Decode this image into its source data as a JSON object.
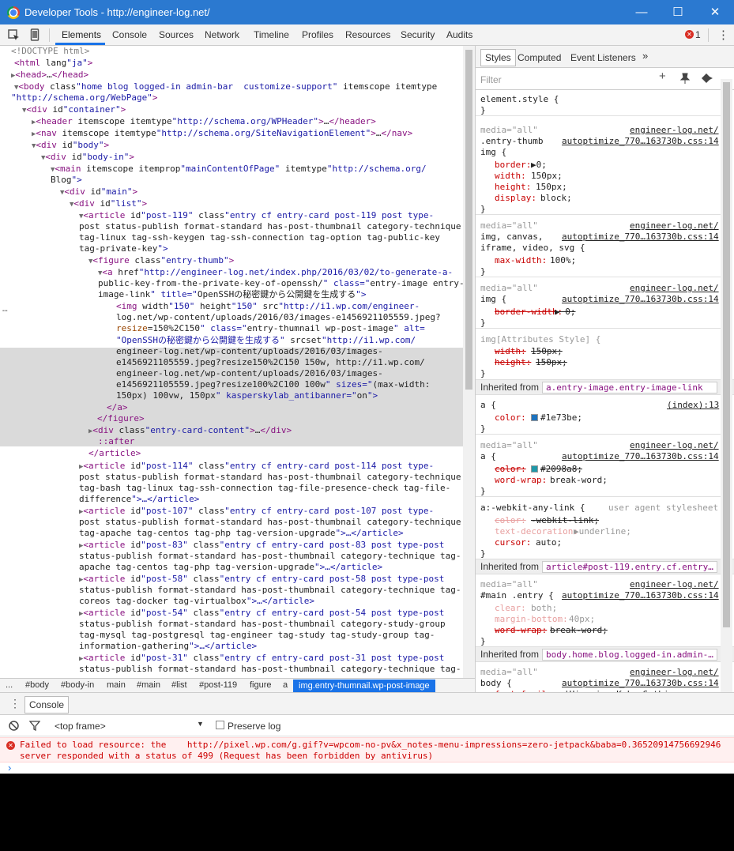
{
  "window": {
    "title": "Developer Tools - http://engineer-log.net/",
    "minimize": "—",
    "maximize": "☐",
    "close": "✕"
  },
  "toolbar": {
    "tabs": [
      "Elements",
      "Console",
      "Sources",
      "Network",
      "Timeline",
      "Profiles",
      "Resources",
      "Security",
      "Audits"
    ],
    "error_count": "1",
    "more": "⋮"
  },
  "dom_lines": [
    {
      "t": "<!DOCTYPE html>",
      "cls": "gr"
    },
    {
      "t": "<html lang=\"ja\">"
    },
    {
      "t": "▶<head>…</head>"
    },
    {
      "t": "▼<body class=\"home blog logged-in admin-bar  customize-support\" itemscope itemtype="
    },
    {
      "t": "\"http://schema.org/WebPage\">"
    },
    {
      "t": "▼<div id=\"container\">"
    },
    {
      "t": "▶<header itemscope itemtype=\"http://schema.org/WPHeader\">…</header>"
    },
    {
      "t": "▶<nav itemscope itemtype=\"http://schema.org/SiteNavigationElement\">…</nav>"
    },
    {
      "t": "▼<div id=\"body\">"
    },
    {
      "t": "▼<div id=\"body-in\">"
    },
    {
      "t": "▼<main itemscope itemprop=\"mainContentOfPage\" itemtype=\"http://schema.org/"
    },
    {
      "t": "Blog\">"
    },
    {
      "t": "▼<div id=\"main\">"
    },
    {
      "t": "▼<div id=\"list\">"
    },
    {
      "t": "▼<article id=\"post-119\" class=\"entry cf entry-card post-119 post type-"
    },
    {
      "t": "post status-publish format-standard has-post-thumbnail category-technique"
    },
    {
      "t": "tag-linux tag-ssh-keygen tag-ssh-connection tag-option tag-public-key"
    },
    {
      "t": "tag-private-key\">"
    },
    {
      "t": "▼<figure class=\"entry-thumb\">"
    },
    {
      "t": "▼<a href=\"http://engineer-log.net/index.php/2016/03/02/to-generate-a-"
    },
    {
      "t": "public-key-from-the-private-key-of-openssh/\" class=\"entry-image entry-"
    },
    {
      "t": "image-link\" title=\"OpenSSHの秘密鍵から公開鍵を生成する\">"
    },
    {
      "t": "<img width=\"150\" height=\"150\" src=\"http://i1.wp.com/engineer-"
    },
    {
      "t": "log.net/wp-content/uploads/2016/03/images-e1456921105559.jpeg?"
    },
    {
      "t": "resize=150%2C150\" class=\"entry-thumnail wp-post-image\" alt="
    },
    {
      "t": "\"OpenSSHの秘密鍵から公開鍵を生成する\" srcset=\"http://i1.wp.com/"
    },
    {
      "t": "engineer-log.net/wp-content/uploads/2016/03/images-"
    },
    {
      "t": "e1456921105559.jpeg?resize=150%2C150 150w, http://i1.wp.com/"
    },
    {
      "t": "engineer-log.net/wp-content/uploads/2016/03/images-"
    },
    {
      "t": "e1456921105559.jpeg?resize=100%2C100 100w\" sizes=\"(max-width:"
    },
    {
      "t": "150px) 100vw, 150px\" kasperskylab_antibanner=\"on\">"
    },
    {
      "t": "</a>"
    },
    {
      "t": "</figure>"
    },
    {
      "t": "▶<div class=\"entry-card-content\">…</div>"
    },
    {
      "t": "::after"
    },
    {
      "t": "</article>"
    },
    {
      "t": "▶<article id=\"post-114\" class=\"entry cf entry-card post-114 post type-"
    },
    {
      "t": "post status-publish format-standard has-post-thumbnail category-technique"
    },
    {
      "t": "tag-bash tag-linux tag-ssh-connection tag-file-presence-check tag-file-"
    },
    {
      "t": "difference\">…</article>"
    },
    {
      "t": "▶<article id=\"post-107\" class=\"entry cf entry-card post-107 post type-"
    },
    {
      "t": "post status-publish format-standard has-post-thumbnail category-technique"
    },
    {
      "t": "tag-apache tag-centos tag-php tag-version-upgrade\">…</article>"
    },
    {
      "t": "▶<article id=\"post-83\" class=\"entry cf entry-card post-83 post type-post"
    },
    {
      "t": "status-publish format-standard has-post-thumbnail category-technique tag-"
    },
    {
      "t": "apache tag-centos tag-php tag-version-upgrade\">…</article>"
    },
    {
      "t": "▶<article id=\"post-58\" class=\"entry cf entry-card post-58 post type-post"
    },
    {
      "t": "status-publish format-standard has-post-thumbnail category-technique tag-"
    },
    {
      "t": "coreos tag-docker tag-virtualbox\">…</article>"
    },
    {
      "t": "▶<article id=\"post-54\" class=\"entry cf entry-card post-54 post type-post"
    },
    {
      "t": "status-publish format-standard has-post-thumbnail category-study-group"
    },
    {
      "t": "tag-mysql tag-postgresql tag-engineer tag-study tag-study-group tag-"
    },
    {
      "t": "information-gathering\">…</article>"
    },
    {
      "t": "▶<article id=\"post-31\" class=\"entry cf entry-card post-31 post type-post"
    },
    {
      "t": "status-publish format-standard has-post-thumbnail category-technique tag-"
    }
  ],
  "breadcrumbs": [
    "...",
    "#body",
    "#body-in",
    "main",
    "#main",
    "#list",
    "#post-119",
    "figure",
    "a",
    "img.entry-thumnail.wp-post-image"
  ],
  "styles": {
    "tabs": [
      "Styles",
      "Computed",
      "Event Listeners",
      "»"
    ],
    "filter_placeholder": "Filter",
    "lines": [
      "element.style {",
      "}",
      "media=\"all\"",
      "engineer-log.net/",
      ".entry-thumb",
      "autoptimize_770…163730b.css:14",
      "img {",
      "border:",
      "▶0;",
      "width:",
      "150px;",
      "height:",
      "150px;",
      "display:",
      "block;",
      "}",
      "media=\"all\"",
      "engineer-log.net/",
      "img, canvas,",
      "autoptimize_770…163730b.css:14",
      "iframe, video, svg {",
      "max-width:",
      "100%;",
      "}",
      "media=\"all\"",
      "engineer-log.net/",
      "img {",
      "autoptimize_770…163730b.css:14",
      "border-width:",
      "▶ 0;",
      "}",
      "img[Attributes Style] {",
      "width:",
      "150px;",
      "height:",
      "150px;",
      "}",
      "Inherited from",
      "a.entry-image.entry-image-link",
      "a {",
      "(index):13",
      "color:",
      "#1e73be;",
      "}",
      "media=\"all\"",
      "engineer-log.net/",
      "a {",
      "autoptimize_770…163730b.css:14",
      "color:",
      "#2098a8;",
      "word-wrap:",
      "break-word;",
      "}",
      "a:-webkit-any-link {",
      "user agent stylesheet",
      "color:",
      "-webkit-link;",
      "text-decoration:",
      "▶underline;",
      "cursor:",
      "auto;",
      "}",
      "Inherited from",
      "article#post-119.entry.cf.entry…",
      "media=\"all\"",
      "engineer-log.net/",
      "#main .entry {",
      "autoptimize_770…163730b.css:14",
      "clear:",
      "both;",
      "margin-bottom:",
      "40px;",
      "word-wrap:",
      "break-word;",
      "}",
      "Inherited from",
      "body.home.blog.logged-in.admin-…",
      "media=\"all\"",
      "engineer-log.net/",
      "body {",
      "autoptimize_770…163730b.css:14",
      "font-family:",
      "'Hiragino Kaku Gothic"
    ],
    "colors": {
      "link_blue": "#1e73be",
      "teal": "#2098a8"
    }
  },
  "drawer": {
    "tab": "Console",
    "frame": "<top frame>",
    "preserve_log": "Preserve log",
    "error_line1": "Failed to load resource: the    http://pixel.wp.com/g.gif?v=wpcom-no-pv&x_notes-menu-impressions=zero-jetpack&baba=0.36520914756692946",
    "error_line2": "server responded with a status of 499 (Request has been forbidden by antivirus)",
    "prompt": "›"
  }
}
